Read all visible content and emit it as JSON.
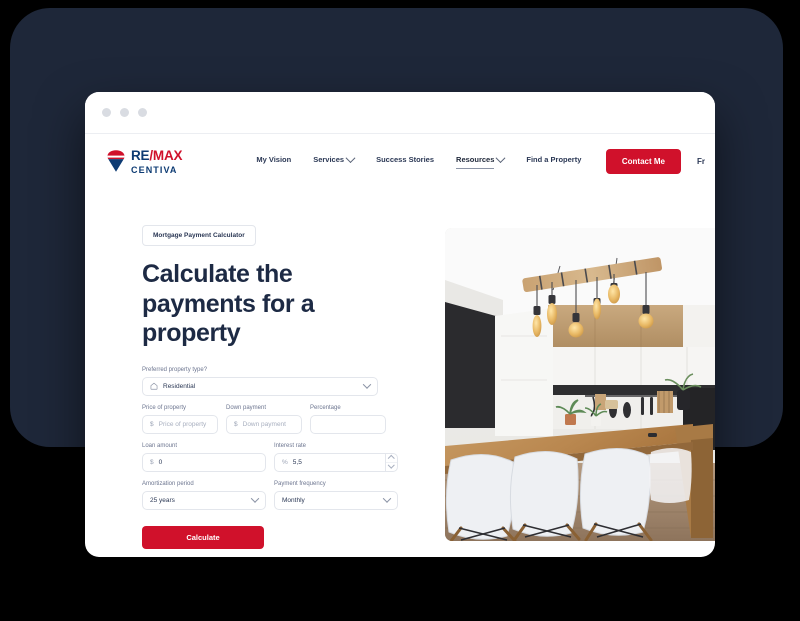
{
  "window": {
    "dots": [
      "dot-red",
      "dot-yellow",
      "dot-green"
    ]
  },
  "header": {
    "logo": {
      "re": "RE",
      "slash": "/",
      "max": "MAX",
      "sub": "CENTIVA",
      "icon": "remax-balloon-icon"
    },
    "nav": [
      {
        "label": "My Vision",
        "has_chevron": false,
        "active": false
      },
      {
        "label": "Services",
        "has_chevron": true,
        "active": false
      },
      {
        "label": "Success Stories",
        "has_chevron": false,
        "active": false
      },
      {
        "label": "Resources",
        "has_chevron": true,
        "active": true
      },
      {
        "label": "Find a Property",
        "has_chevron": false,
        "active": false
      }
    ],
    "contact_label": "Contact Me",
    "language": "Fr"
  },
  "main": {
    "badge": "Mortgage Payment Calculator",
    "headline": "Calculate the payments for a property",
    "form": {
      "property_type": {
        "label": "Preferred property type?",
        "value": "Residential",
        "icon": "home-icon",
        "options": [
          "Residential"
        ]
      },
      "price": {
        "label": "Price of property",
        "prefix": "$",
        "value": "",
        "placeholder": "Price of property"
      },
      "down_payment": {
        "label": "Down payment",
        "prefix": "$",
        "value": "",
        "placeholder": "Down payment"
      },
      "percentage": {
        "label": "Percentage",
        "value": "",
        "placeholder": ""
      },
      "loan_amount": {
        "label": "Loan amount",
        "prefix": "$",
        "value": "0"
      },
      "interest_rate": {
        "label": "Interest rate",
        "prefix": "%",
        "value": "5,5",
        "stepper": true
      },
      "amortization": {
        "label": "Amortization period",
        "value": "25 years",
        "options": [
          "25 years"
        ]
      },
      "frequency": {
        "label": "Payment frequency",
        "value": "Monthly",
        "options": [
          "Monthly"
        ]
      },
      "submit_label": "Calculate"
    }
  },
  "photo": {
    "alt": "Modern kitchen with wooden beam pendant lights, dining table and white chairs"
  },
  "colors": {
    "backdrop_navy": "#1e2739",
    "brand_red": "#d0112b",
    "brand_blue": "#0d3b73",
    "heading": "#1d2a44",
    "page_bg": "#000000"
  }
}
